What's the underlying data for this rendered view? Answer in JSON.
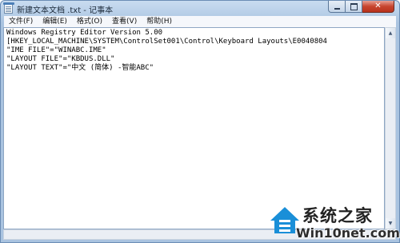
{
  "window": {
    "title": "新建文本文档 .txt - 记事本",
    "minimize_icon": "minimize-icon",
    "maximize_icon": "maximize-icon",
    "close_icon": "close-icon",
    "close_symbol": "✕"
  },
  "menubar": {
    "items": [
      {
        "label": "文件(F)"
      },
      {
        "label": "编辑(E)"
      },
      {
        "label": "格式(O)"
      },
      {
        "label": "查看(V)"
      },
      {
        "label": "帮助(H)"
      }
    ]
  },
  "editor": {
    "lines": [
      "Windows Registry Editor Version 5.00",
      "[HKEY_LOCAL_MACHINE\\SYSTEM\\ControlSet001\\Control\\Keyboard Layouts\\E0040804",
      "\"IME FILE\"=\"WINABC.IME\"",
      "\"LAYOUT FILE\"=\"KBDUS.DLL\"",
      "\"LAYOUT TEXT\"=\"中文 (简体) -智能ABC\""
    ]
  },
  "scrollbar": {
    "up_arrow": "▲",
    "down_arrow": "▼"
  },
  "watermark": {
    "brand_cn": "系统之家",
    "url": "Win10net.com",
    "logo_icon": "house-logo-icon",
    "logo_color": "#1a8fd8"
  }
}
